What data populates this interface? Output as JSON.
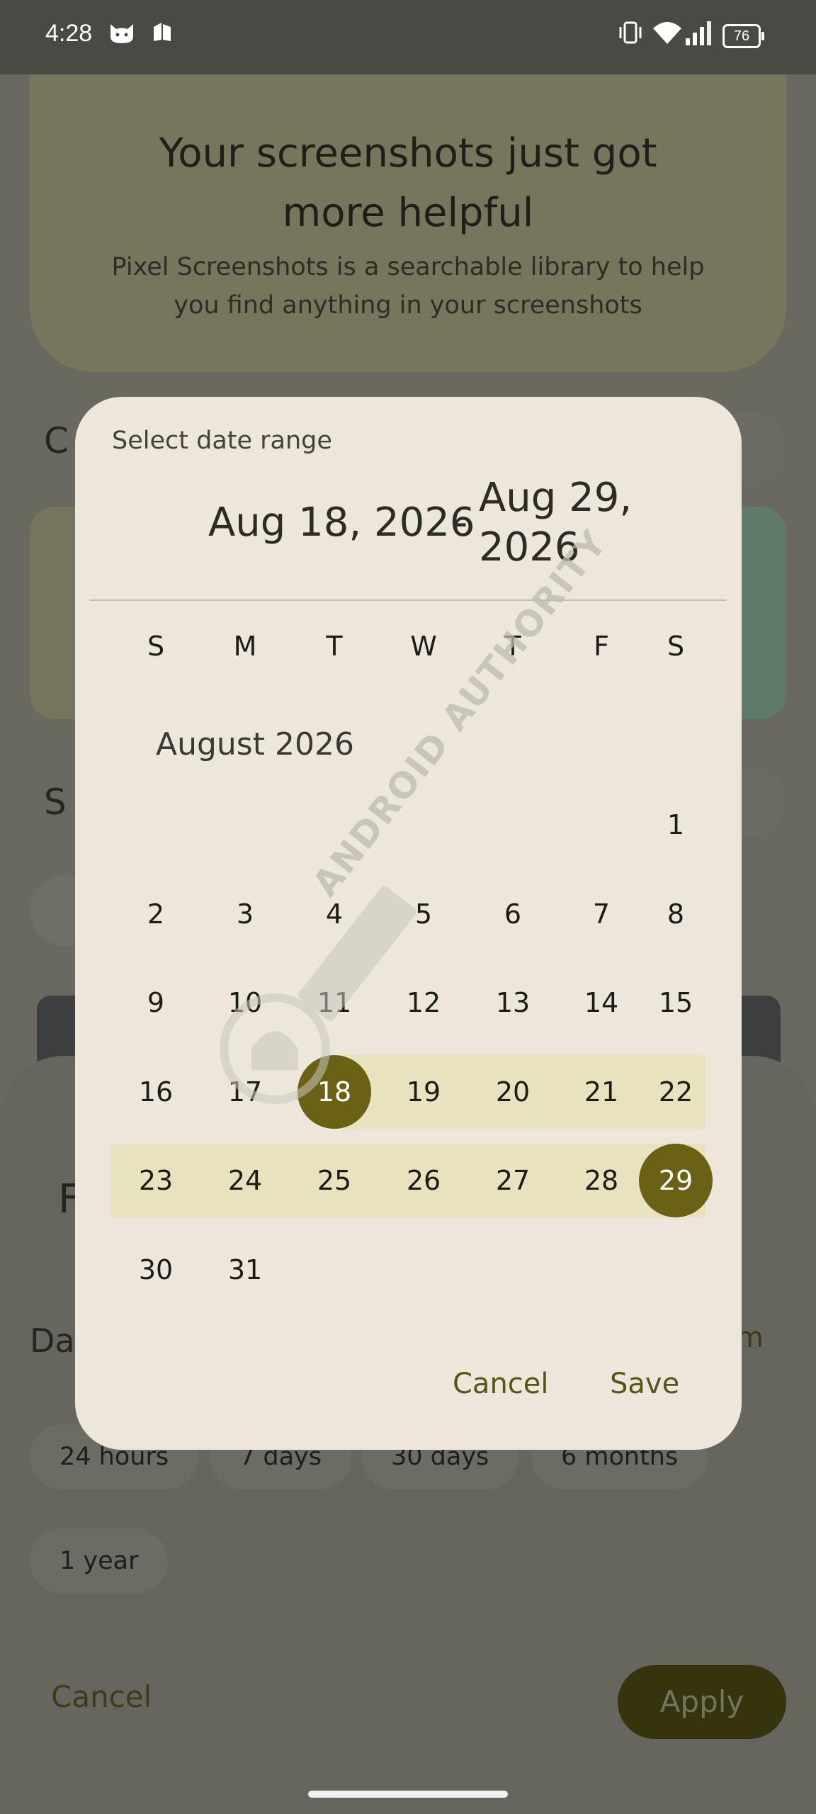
{
  "status_bar": {
    "time": "4:28",
    "battery": "76",
    "icons": [
      "cat-notification-icon",
      "app-notification-icon",
      "vibrate-icon",
      "wifi-icon",
      "signal-icon",
      "battery-icon"
    ]
  },
  "background": {
    "hero_title": "Your screenshots just got more helpful",
    "hero_subtitle": "Pixel Screenshots is a searchable library to help you find anything in your screenshots",
    "section_c_partial": "C",
    "section_s_partial": "S",
    "filter_sheet": {
      "title_partial": "F",
      "date_label_partial": "Da",
      "custom_partial": "m",
      "chips": [
        "24 hours",
        "7 days",
        "30 days",
        "6 months",
        "1 year"
      ],
      "cancel": "Cancel",
      "apply": "Apply"
    }
  },
  "dialog": {
    "title": "Select date range",
    "start_date": "Aug 18, 2026",
    "separator": "-",
    "end_date": "Aug 29, 2026",
    "weekdays": [
      "S",
      "M",
      "T",
      "W",
      "T",
      "F",
      "S"
    ],
    "month_label": "August 2026",
    "first_weekday_index": 6,
    "days_in_month": 31,
    "range_start": 18,
    "range_end": 29,
    "cancel": "Cancel",
    "save": "Save"
  },
  "watermark": "ANDROID AUTHORITY",
  "colors": {
    "dialog_bg": "#ece7da",
    "range_band": "#e8e2be",
    "selected": "#6a6114",
    "accent_text": "#5b5417",
    "scrim": "#69695f"
  }
}
